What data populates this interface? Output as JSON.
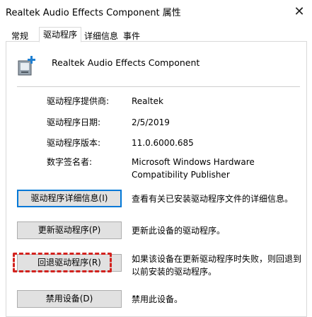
{
  "window": {
    "title": "Realtek Audio Effects Component 属性",
    "close_glyph": "✕"
  },
  "tabs": [
    {
      "label": "常规"
    },
    {
      "label": "驱动程序"
    },
    {
      "label": "详细信息"
    },
    {
      "label": "事件"
    }
  ],
  "device": {
    "name": "Realtek Audio Effects Component",
    "icon": "audio-device-icon"
  },
  "properties": [
    {
      "label": "驱动程序提供商:",
      "value": "Realtek"
    },
    {
      "label": "驱动程序日期:",
      "value": "2/5/2019"
    },
    {
      "label": "驱动程序版本:",
      "value": "11.0.6000.685"
    },
    {
      "label": "数字签名者:",
      "value": "Microsoft Windows Hardware Compatibility Publisher"
    }
  ],
  "actions": [
    {
      "label": "驱动程序详细信息(I)",
      "description": "查看有关已安装驱动程序文件的详细信息。"
    },
    {
      "label": "更新驱动程序(P)",
      "description": "更新此设备的驱动程序。"
    },
    {
      "label": "回退驱动程序(R)",
      "description": "如果该设备在更新驱动程序时失败，则回退到以前安装的驱动程序。"
    },
    {
      "label": "禁用设备(D)",
      "description": "禁用此设备。"
    }
  ],
  "colors": {
    "highlight": "#d3221e",
    "focus": "#0078d7"
  }
}
